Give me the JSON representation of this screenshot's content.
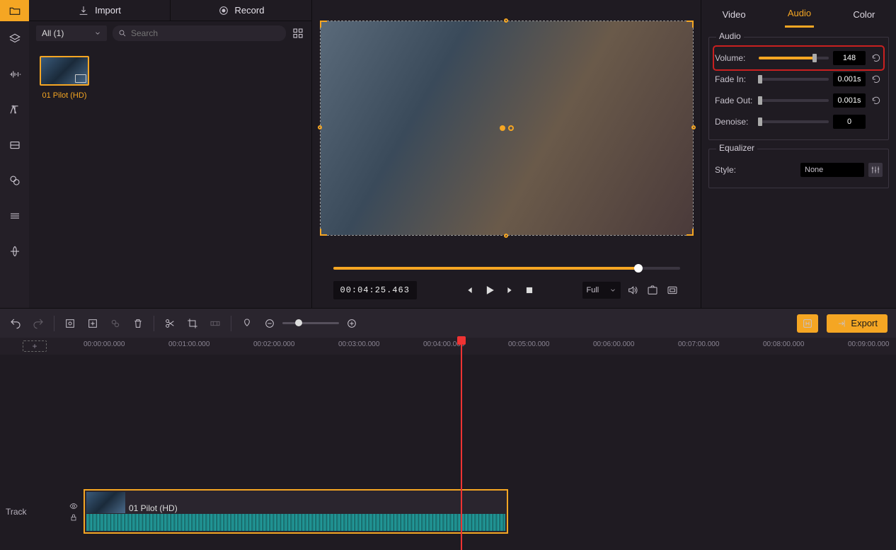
{
  "sidebar": {
    "items": [
      "media",
      "filters",
      "audio",
      "text",
      "overlays",
      "elements",
      "transitions",
      "effects"
    ]
  },
  "mediaPanel": {
    "importLabel": "Import",
    "recordLabel": "Record",
    "filterLabel": "All (1)",
    "searchPlaceholder": "Search",
    "thumbLabel": "01 Pilot (HD)"
  },
  "preview": {
    "timecode": "00:04:25.463",
    "sizeLabel": "Full",
    "scrubPercent": 88
  },
  "propTabs": {
    "video": "Video",
    "audio": "Audio",
    "color": "Color"
  },
  "audioPanel": {
    "title": "Audio",
    "volume": {
      "label": "Volume:",
      "value": "148",
      "percent": 80
    },
    "fadeIn": {
      "label": "Fade In:",
      "value": "0.001s",
      "percent": 0
    },
    "fadeOut": {
      "label": "Fade Out:",
      "value": "0.001s",
      "percent": 0
    },
    "denoise": {
      "label": "Denoise:",
      "value": "0",
      "percent": 0
    }
  },
  "equalizer": {
    "title": "Equalizer",
    "styleLabel": "Style:",
    "styleValue": "None"
  },
  "toolbar": {
    "exportLabel": "Export"
  },
  "timeline": {
    "ticks": [
      "00:00:00.000",
      "00:01:00.000",
      "00:02:00.000",
      "00:03:00.000",
      "00:04:00.000",
      "00:05:00.000",
      "00:06:00.000",
      "00:07:00.000",
      "00:08:00.000",
      "00:09:00.000"
    ],
    "trackLabel": "Track",
    "clipLabel": "01 Pilot (HD)",
    "playheadX": 651,
    "addLabel": "+"
  }
}
